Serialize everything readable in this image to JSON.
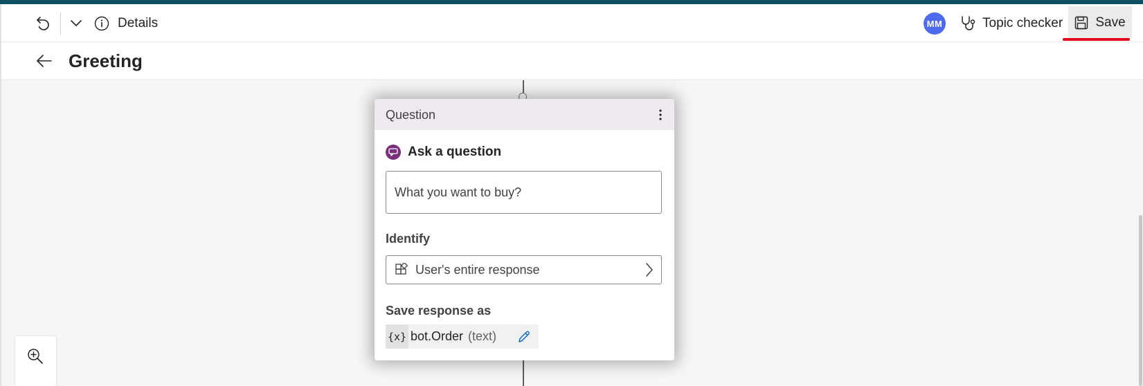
{
  "toolbar": {
    "details_label": "Details",
    "avatar_initials": "MM",
    "topic_checker_label": "Topic checker",
    "save_label": "Save"
  },
  "page": {
    "title": "Greeting"
  },
  "question_node": {
    "header": "Question",
    "ask_label": "Ask a question",
    "question_text": "What you want to buy?",
    "identify_label": "Identify",
    "identify_value": "User's entire response",
    "save_response_label": "Save response as",
    "variable_badge": "{x}",
    "variable_name": "bot.Order",
    "variable_type": "(text)"
  },
  "colors": {
    "top_strip": "#0f4f63",
    "avatar_bg": "#4f6bed",
    "save_highlight": "#e00b1c",
    "node_header_bg": "#efe9f0",
    "question_icon": "#7a2f7a",
    "edit_icon": "#0f6cbd"
  },
  "icons": {
    "undo": "undo-icon",
    "chevron": "chevron-down-icon",
    "details": "info-icon",
    "topic_checker": "stethoscope-icon",
    "save": "save-icon",
    "back": "arrow-left-icon",
    "more": "more-vertical-icon",
    "question": "chat-bubble-icon",
    "identify": "entity-icon",
    "edit": "pencil-icon",
    "zoom": "zoom-in-icon"
  }
}
